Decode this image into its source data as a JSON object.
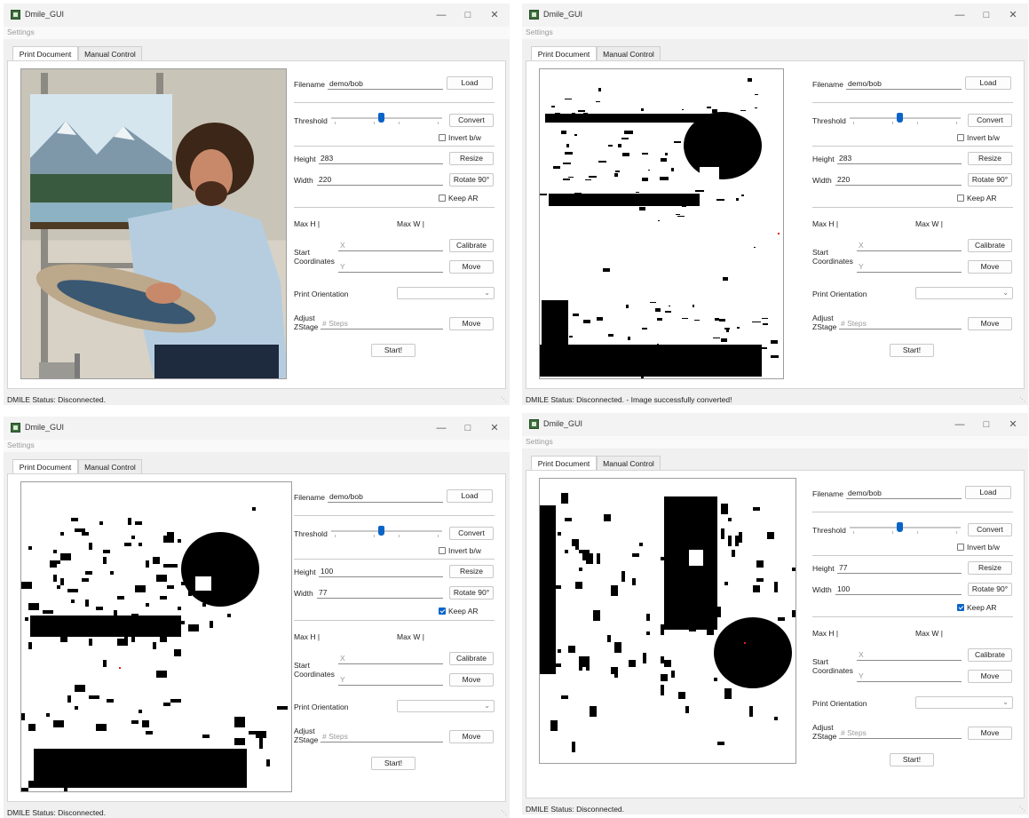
{
  "window_title": "Dmile_GUI",
  "window_title_alt": "Dmile_GUI",
  "menu_settings": "Settings",
  "tabs": [
    "Print Document",
    "Manual Control"
  ],
  "labels": {
    "filename": "Filename",
    "threshold": "Threshold",
    "height": "Height",
    "width": "Width",
    "max_h": "Max H |",
    "max_w": "Max W |",
    "start_coordinates": "Start Coordinates",
    "print_orientation": "Print Orientation",
    "adjust_zstage": "Adjust ZStage"
  },
  "buttons": {
    "load": "Load",
    "convert": "Convert",
    "resize": "Resize",
    "rotate": "Rotate 90°",
    "calibrate": "Calibrate",
    "move": "Move",
    "start": "Start!"
  },
  "checkbox_labels": {
    "invert": "Invert b/w",
    "keep_ar": "Keep AR"
  },
  "placeholders": {
    "x": "X",
    "y": "Y",
    "steps": "# Steps"
  },
  "filename_value": "demo/bob",
  "threshold_level": 0.45,
  "windows": [
    {
      "title": "Dmile_GUI",
      "height_value": "283",
      "width_value": "220",
      "keep_ar": false,
      "invert": false,
      "image": "photo",
      "status": "DMILE Status: Disconnected."
    },
    {
      "title": "Dmile_GUI",
      "height_value": "283",
      "width_value": "220",
      "keep_ar": false,
      "invert": false,
      "image": "bw-full",
      "status": "DMILE Status: Disconnected.  -  Image successfully converted!"
    },
    {
      "title": "Dmile_GUI",
      "height_value": "100",
      "width_value": "77",
      "keep_ar": true,
      "invert": false,
      "image": "bw-pixel",
      "status": "DMILE Status: Disconnected."
    },
    {
      "title": "Dmile_GUI",
      "height_value": "77",
      "width_value": "100",
      "keep_ar": true,
      "invert": false,
      "image": "bw-rotated",
      "status": "DMILE Status: Disconnected."
    }
  ],
  "icons": {
    "app": "app-logo-icon",
    "minimize": "minimize-icon",
    "maximize": "maximize-icon",
    "close": "close-icon",
    "chevron": "chevron-down-icon",
    "check": "checkmark-icon"
  },
  "colors": {
    "accent": "#0a64c8",
    "marker": "#e31b1b"
  }
}
